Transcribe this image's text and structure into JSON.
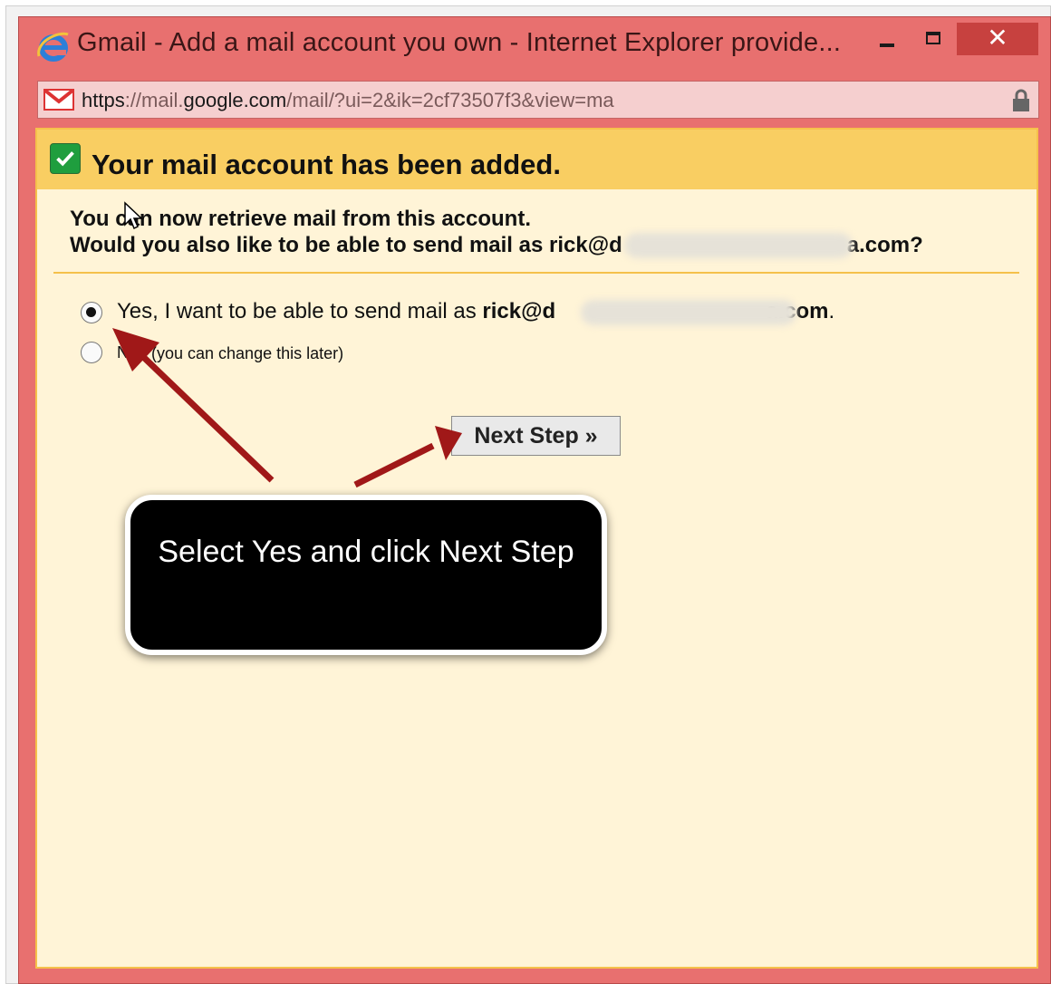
{
  "window": {
    "title": "Gmail - Add a mail account you own - Internet Explorer provide...",
    "close_glyph": "✕"
  },
  "address": {
    "url_scheme": "https",
    "url_sep1": "://mail.",
    "url_domain": "google.com",
    "url_rest": "/mail/?ui=2&ik=2cf73507f3&view=ma"
  },
  "banner": {
    "title": "Your mail account has been added."
  },
  "info": {
    "line1": "You can now retrieve mail from this account.",
    "line2_prefix": "Would you also like to be able to send mail as rick@d",
    "line2_suffix": "a.com?"
  },
  "options": {
    "yes_prefix": "Yes, I want to be able to send mail as ",
    "yes_email_start": "rick@d",
    "yes_email_end": "a.com",
    "yes_period": ".",
    "no_label": "No",
    "no_hint": "(you can change this later)",
    "selected": "yes"
  },
  "next_button": {
    "label": "Next Step »"
  },
  "callout": {
    "text": "Select Yes and click Next Step"
  },
  "colors": {
    "window_frame": "#e8706f",
    "banner": "#f9ce62",
    "content_bg": "#fff4d7",
    "arrow": "#a01818"
  },
  "icons": [
    "ie-logo-icon",
    "gmail-icon",
    "lock-icon",
    "minimize-icon",
    "maximize-icon",
    "close-icon",
    "checkmark-icon",
    "arrow-pointer-icon",
    "mouse-cursor-icon"
  ]
}
